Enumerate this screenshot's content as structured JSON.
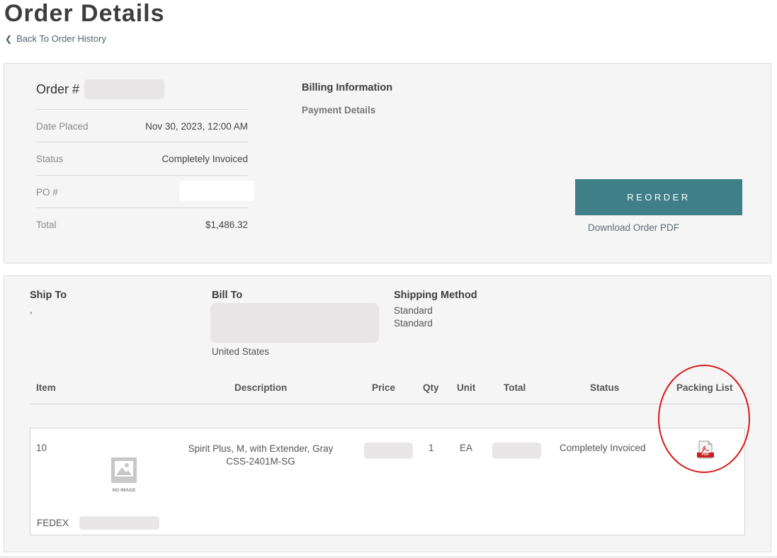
{
  "header": {
    "title": "Order Details",
    "back_label": "Back To Order History"
  },
  "order": {
    "order_label": "Order #",
    "rows": [
      {
        "label": "Date Placed",
        "value": "Nov 30, 2023, 12:00 AM"
      },
      {
        "label": "Status",
        "value": "Completely Invoiced"
      },
      {
        "label": "PO #",
        "value": ""
      },
      {
        "label": "Total",
        "value": "$1,486.32"
      }
    ],
    "billing_heading": "Billing Information",
    "payment_heading": "Payment Details",
    "reorder_label": "REORDER",
    "download_label": "Download Order PDF"
  },
  "shipping": {
    "ship_to_heading": "Ship To",
    "ship_to_text": ",",
    "bill_to_heading": "Bill To",
    "bill_to_country": "United States",
    "method_heading": "Shipping Method",
    "method_line1": "Standard",
    "method_line2": "Standard"
  },
  "table": {
    "headers": {
      "item": "Item",
      "description": "Description",
      "price": "Price",
      "qty": "Qty",
      "unit": "Unit",
      "total": "Total",
      "status": "Status",
      "packing": "Packing List"
    },
    "row": {
      "item": "10",
      "no_image": "NO IMAGE",
      "desc_line1": "Spirit Plus, M, with Extender, Gray",
      "desc_line2": "CSS-2401M-SG",
      "qty": "1",
      "unit": "EA",
      "status": "Completely Invoiced",
      "pdf_badge": "PDF",
      "carrier": "FEDEX"
    }
  },
  "colors": {
    "accent": "#3f7f88",
    "annotation": "#d81818",
    "pdf_red": "#c8201e"
  },
  "icons": {
    "back": "chevron-left-icon",
    "image_placeholder": "image-placeholder-icon",
    "packing": "pdf-icon"
  }
}
